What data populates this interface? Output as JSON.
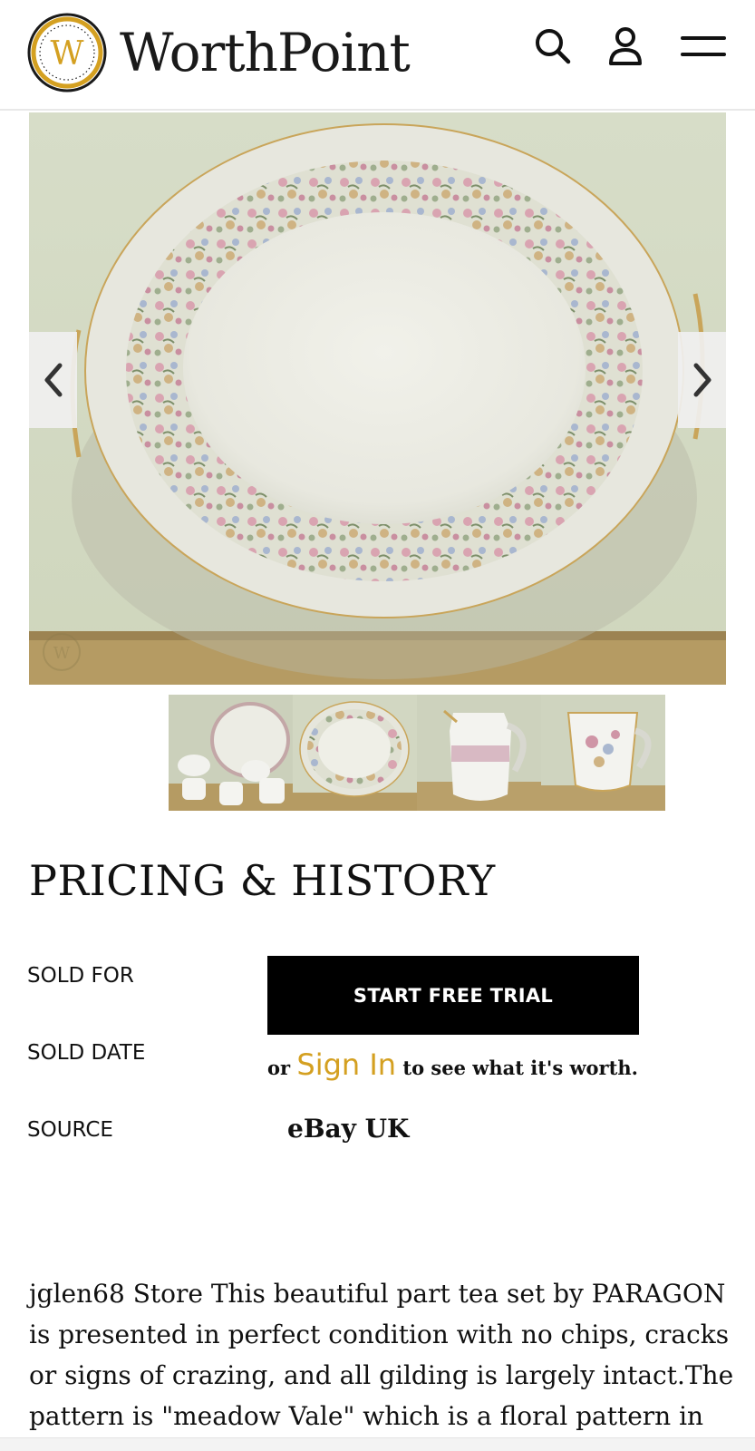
{
  "header": {
    "logo_letter": "W",
    "logo_text": "WorthPoint",
    "icons": [
      "search-icon",
      "user-icon",
      "menu-icon"
    ]
  },
  "gallery": {
    "thumbnail_count": 4,
    "prev_icon": "chevron-left-icon",
    "next_icon": "chevron-right-icon"
  },
  "pricing": {
    "title": "PRICING & HISTORY",
    "sold_for_label": "SOLD FOR",
    "sold_date_label": "SOLD DATE",
    "source_label": "SOURCE",
    "trial_button": "START FREE TRIAL",
    "or_text": "or",
    "sign_in_text": "Sign In",
    "worth_text": "to see what it's worth.",
    "source_value": "eBay UK"
  },
  "description": "jglen68 Store This beautiful part tea set by PARAGON is presented in perfect condition with no chips, cracks or signs of crazing, and all gilding is largely intact.The pattern is \"meadow Vale\" which is a floral pattern in",
  "colors": {
    "accent": "#d4a021",
    "button_bg": "#000000"
  }
}
